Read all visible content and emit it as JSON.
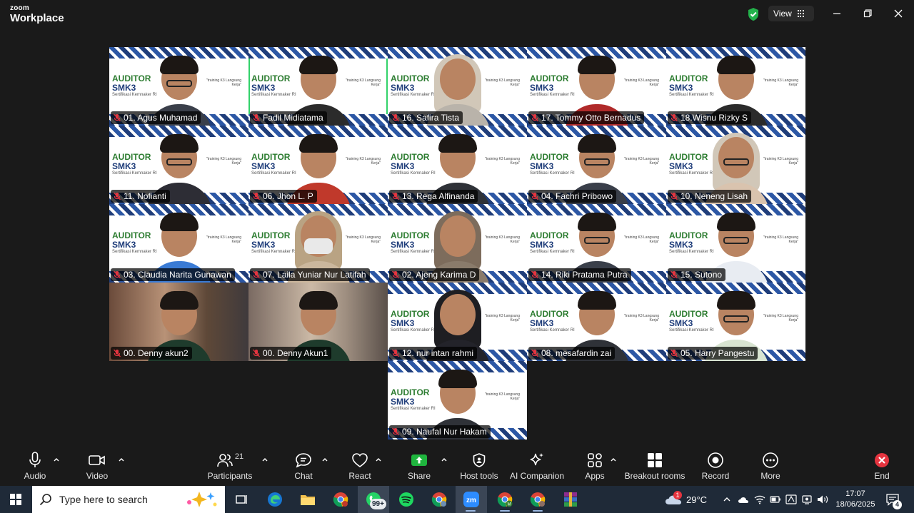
{
  "titlebar": {
    "brand_top": "zoom",
    "brand_bottom": "Workplace",
    "view_label": "View"
  },
  "participants": [
    {
      "name": "01. Agus Muhamad",
      "style": "man-glasses"
    },
    {
      "name": "Fadil Midiatama",
      "style": "man",
      "active": true
    },
    {
      "name": "16. Safira Tista",
      "style": "hijab-light"
    },
    {
      "name": "17. Tommy Otto Bernadus",
      "style": "man-red"
    },
    {
      "name": "18.Wisnu Rizky S",
      "style": "man"
    },
    {
      "name": "11. Nofianti",
      "style": "woman-glasses"
    },
    {
      "name": "06. Jhon L. P",
      "style": "man-headset"
    },
    {
      "name": "13. Rega Alfinanda",
      "style": "man-dark"
    },
    {
      "name": "04. Fachri Pribowo",
      "style": "man-glasses"
    },
    {
      "name": "10. Neneng Lisah",
      "style": "hijab-glasses"
    },
    {
      "name": "03. Claudia Narita Gunawan",
      "style": "woman-blue"
    },
    {
      "name": "07. Laila Yuniar Nur Latifah",
      "style": "hijab-mask"
    },
    {
      "name": "02. Ajeng Karima D",
      "style": "hijab-small"
    },
    {
      "name": "14. Riki Pratama Putra",
      "style": "man-glasses"
    },
    {
      "name": "15. Sutono",
      "style": "man-glasses-white"
    },
    {
      "name": "00. Denny akun2",
      "style": "room"
    },
    {
      "name": "00. Denny Akun1",
      "style": "room2"
    },
    {
      "name": "12. nur intan rahmi",
      "style": "hijab-black"
    },
    {
      "name": "08. mesafardin zai",
      "style": "man-dark"
    },
    {
      "name": "05. Harry Pangestu",
      "style": "man-glasses-young"
    },
    {
      "name": "09. Naufal Nur Hakam",
      "style": "man-dark"
    }
  ],
  "background": {
    "auditor": "AUDITOR",
    "smk3": "SMK3",
    "sertifikasi": "Sertifikasi Kemnaker RI",
    "training": "\"training K3 Langsung Kerja\""
  },
  "toolbar": {
    "audio": "Audio",
    "video": "Video",
    "participants": "Participants",
    "participants_count": "21",
    "chat": "Chat",
    "react": "React",
    "share": "Share",
    "host_tools": "Host tools",
    "ai_companion": "AI Companion",
    "apps": "Apps",
    "breakout_rooms": "Breakout rooms",
    "record": "Record",
    "more": "More",
    "end": "End"
  },
  "taskbar": {
    "search_placeholder": "Type here to search",
    "whatsapp_badge": "99+",
    "temperature": "29°C",
    "weather_badge": "1",
    "time": "17:07",
    "date": "18/06/2025",
    "notification_count": "4"
  },
  "colors": {
    "active_speaker": "#32d26a",
    "share_green": "#1fb53e",
    "end_red": "#e5343f",
    "taskbar": "#1f2a38"
  }
}
